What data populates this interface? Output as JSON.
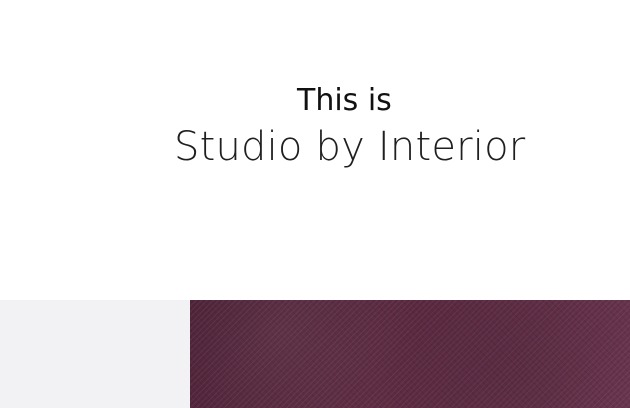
{
  "hero": {
    "eyebrow": "This is",
    "title": "Studio by Interior"
  },
  "colors": {
    "background": "#ffffff",
    "light_panel": "#f2f1f3",
    "fabric_primary": "#5b2941",
    "text_primary": "#111111"
  }
}
